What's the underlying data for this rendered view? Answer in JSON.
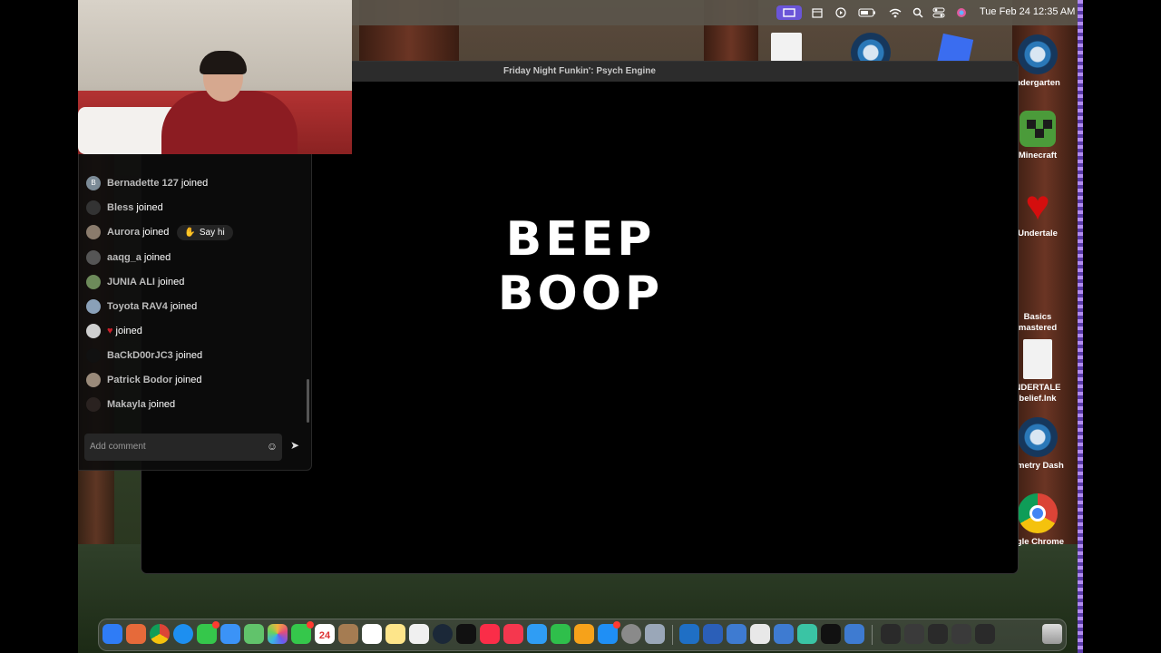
{
  "menubar": {
    "clock": "Tue Feb 24  12:35 AM",
    "items": [
      "screen-share-icon",
      "calendar-icon",
      "play-icon",
      "battery-icon",
      "wifi-icon",
      "spotlight-icon",
      "control-center-icon",
      "siri-icon"
    ]
  },
  "game_window": {
    "title": "Friday Night Funkin': Psych Engine",
    "text": "BEEP BOOP"
  },
  "desktop_icons": [
    {
      "label": "ndergarten",
      "icon": "steam-icon"
    },
    {
      "label": "Minecraft",
      "icon": "minecraft-icon"
    },
    {
      "label": "Undertale",
      "icon": "undertale-heart-icon"
    },
    {
      "label": "Basics\nmastered",
      "icon": "folder-icon"
    },
    {
      "label": "NDERTALE\n belief.lnk",
      "icon": "document-icon"
    },
    {
      "label": "ometry Dash",
      "icon": "steam-icon"
    },
    {
      "label": "ogle Chrome",
      "icon": "chrome-icon"
    }
  ],
  "chat": {
    "rows": [
      {
        "name": "Bernadette 127",
        "action": "joined",
        "avatar": "B"
      },
      {
        "name": "Bless",
        "action": "joined",
        "avatar": ""
      },
      {
        "name": "Aurora",
        "action": "joined",
        "avatar": "",
        "button": "Say hi"
      },
      {
        "name": "aaqg_a",
        "action": "joined",
        "avatar": ""
      },
      {
        "name": "JUNIA ALI",
        "action": "joined",
        "avatar": ""
      },
      {
        "name": "Toyota RAV4",
        "action": "joined",
        "avatar": ""
      },
      {
        "name": "♥",
        "action": "joined",
        "avatar": ""
      },
      {
        "name": "BaCkD00rJC3",
        "action": "joined",
        "avatar": ""
      },
      {
        "name": "Patrick Bodor",
        "action": "joined",
        "avatar": ""
      },
      {
        "name": "Makayla",
        "action": "joined",
        "avatar": ""
      }
    ],
    "comment_placeholder": "Add comment"
  },
  "dock": {
    "calendar_day": "24"
  },
  "colors": {
    "menubar_active": "#6a55d8",
    "heart": "#d40e0e",
    "chat_bg": "#0c0c0c"
  }
}
